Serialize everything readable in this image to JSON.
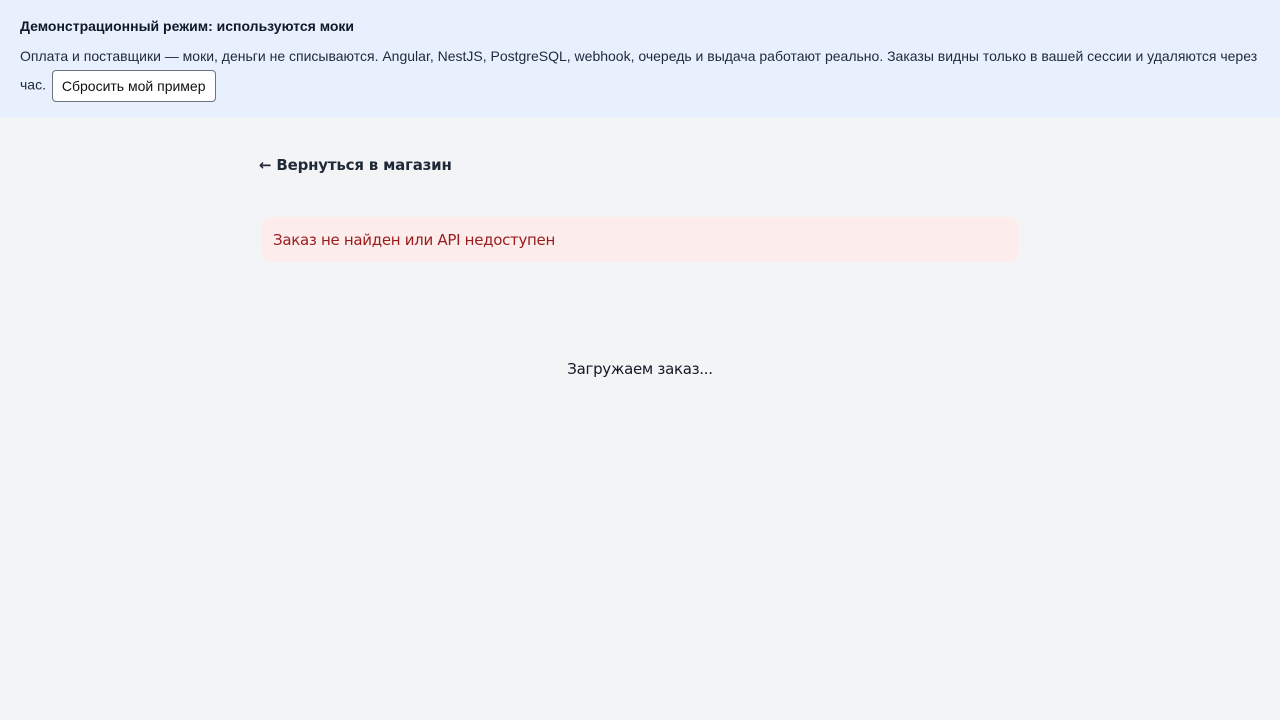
{
  "banner": {
    "title": "Демонстрационный режим: используются моки",
    "text": "Оплата и поставщики — моки, деньги не списываются. Angular, NestJS, PostgreSQL, webhook, очередь и выдача работают реально. Заказы видны только в вашей сессии и удаляются через час.",
    "reset_button": "Сбросить мой пример"
  },
  "nav": {
    "back_link": "← Вернуться в магазин"
  },
  "error": {
    "message": "Заказ не найден или API недоступен"
  },
  "status": {
    "loading": "Загружаем заказ..."
  },
  "colors": {
    "banner_bg": "#e8f0fe",
    "page_bg": "#f3f4f6",
    "error_bg": "#fdecec",
    "error_text": "#991b1b"
  }
}
